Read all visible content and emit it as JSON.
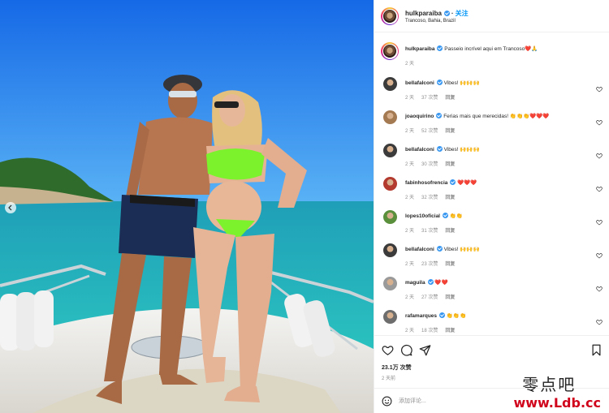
{
  "post": {
    "username": "hulkparaiba",
    "follow_label": "关注",
    "location": "Trancoso, Bahia, Brazil",
    "caption": {
      "username": "hulkparaiba",
      "text": "Passeio incrível aqui em Trancoso",
      "emojis": "❤️🙏",
      "time": "2 天"
    },
    "likes": "23.1万 次赞",
    "time": "2 天前",
    "comment_placeholder": "添加评论..."
  },
  "comments": [
    {
      "username": "bellafalconi",
      "text": "Vibes!",
      "emojis": "🙌🙌🙌",
      "time": "2 天",
      "likes": "37 次赞",
      "reply": "回复",
      "avatar_color": "#3b3b3b"
    },
    {
      "username": "joaoquirino",
      "text": "Ferias mais que merecidas!",
      "emojis": "👏👏👏❤️❤️❤️",
      "time": "2 天",
      "likes": "52 次赞",
      "reply": "回复",
      "avatar_color": "#a37a52"
    },
    {
      "username": "bellafalconi",
      "text": "Vibes!",
      "emojis": "🙌🙌🙌",
      "time": "2 天",
      "likes": "30 次赞",
      "reply": "回复",
      "avatar_color": "#3b3b3b"
    },
    {
      "username": "fabinhosofrencia",
      "text": "",
      "emojis": "❤️❤️❤️",
      "time": "2 天",
      "likes": "32 次赞",
      "reply": "回复",
      "avatar_color": "#b23a2e"
    },
    {
      "username": "lopes10oficial",
      "text": "",
      "emojis": "👏👏",
      "time": "2 天",
      "likes": "31 次赞",
      "reply": "回复",
      "avatar_color": "#5a8f3c"
    },
    {
      "username": "bellafalconi",
      "text": "Vibes!",
      "emojis": "🙌🙌🙌",
      "time": "2 天",
      "likes": "23 次赞",
      "reply": "回复",
      "avatar_color": "#3b3b3b"
    },
    {
      "username": "maguila",
      "text": "",
      "emojis": "❤️❤️",
      "time": "2 天",
      "likes": "27 次赞",
      "reply": "回复",
      "avatar_color": "#9a9a9a"
    },
    {
      "username": "rafamarques",
      "text": "",
      "emojis": "👏👏👏",
      "time": "2 天",
      "likes": "18 次赞",
      "reply": "回复",
      "avatar_color": "#6d6d6d"
    }
  ],
  "watermark": {
    "chinese": "零点吧",
    "url": "www.Ldb.cc"
  },
  "colors": {
    "accent": "#0095f6",
    "verified": "#3897f0",
    "meta_text": "#8e8e8e"
  },
  "icons": [
    "more-options-icon",
    "heart-icon",
    "comment-icon",
    "share-icon",
    "save-icon",
    "emoji-icon",
    "chevron-left-icon",
    "verified-badge-icon"
  ]
}
